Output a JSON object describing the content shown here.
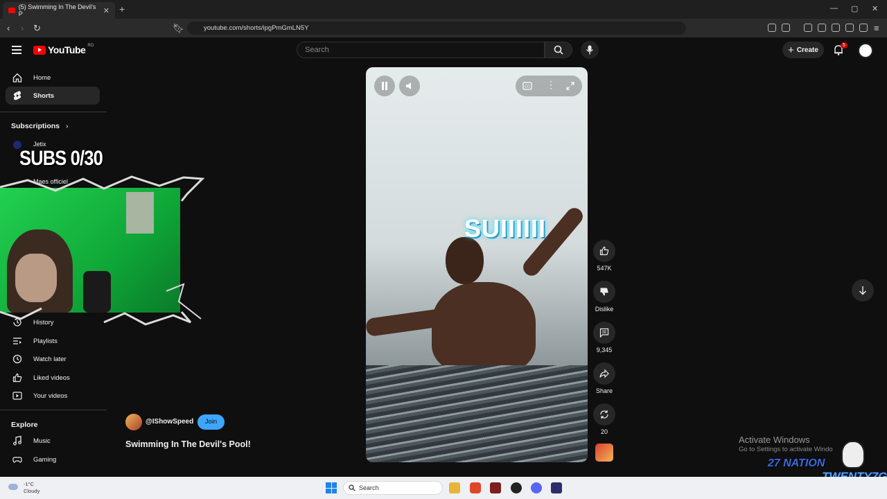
{
  "browser": {
    "tab_title": "(5) Swimming In The Devil's P",
    "url": "youtube.com/shorts/ipgPmGmLN5Y"
  },
  "header": {
    "logo_text": "YouTube",
    "country_code": "RO",
    "search_placeholder": "Search",
    "create_label": "Create",
    "notification_count": "5"
  },
  "sidebar": {
    "items": [
      {
        "label": "Home",
        "icon": "home-icon"
      },
      {
        "label": "Shorts",
        "icon": "shorts-icon"
      }
    ],
    "subscriptions_label": "Subscriptions",
    "subscriptions": [
      {
        "label": "Jetix"
      },
      {
        "label": "Maes officiel"
      }
    ],
    "you_items": [
      {
        "label": "History",
        "icon": "history-icon"
      },
      {
        "label": "Playlists",
        "icon": "playlists-icon"
      },
      {
        "label": "Watch later",
        "icon": "clock-icon"
      },
      {
        "label": "Liked videos",
        "icon": "thumbs-up-icon"
      },
      {
        "label": "Your videos",
        "icon": "video-icon"
      }
    ],
    "explore_label": "Explore",
    "explore_items": [
      {
        "label": "Music",
        "icon": "music-icon"
      },
      {
        "label": "Gaming",
        "icon": "gaming-icon"
      }
    ]
  },
  "overlay": {
    "subs_text": "SUBS 0/30"
  },
  "video": {
    "caption_text": "SUIIIIII",
    "channel": "@IShowSpeed",
    "join_label": "Join",
    "title": "Swimming In The Devil's Pool!"
  },
  "actions": {
    "likes": "547K",
    "dislike_label": "Dislike",
    "comments": "9,345",
    "share_label": "Share",
    "remix_count": "20"
  },
  "watermark": {
    "line1": "Activate Windows",
    "line2": "Go to Settings to activate Windo",
    "brand1": "27 NATION",
    "brand2": "TWENTY7G"
  },
  "taskbar": {
    "temp": "-1°C",
    "condition": "Cloudy",
    "search_label": "Search"
  },
  "colors": {
    "accent_red": "#ff0000",
    "join_blue": "#3ea6ff",
    "background": "#0f0f0f"
  }
}
